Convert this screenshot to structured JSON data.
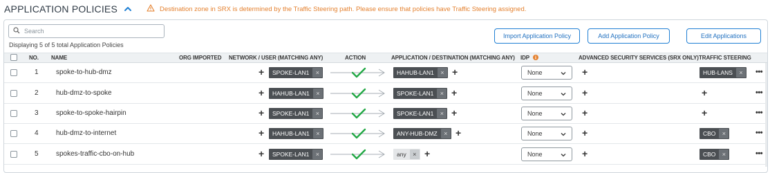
{
  "header": {
    "title": "APPLICATION POLICIES",
    "warning": "Destination zone in SRX is determined by the Traffic Steering path. Please ensure that policies have Traffic Steering assigned."
  },
  "search": {
    "placeholder": "Search",
    "value": ""
  },
  "count_text": "Displaying 5 of 5 total Application Policies",
  "buttons": {
    "import": "Import Application Policy",
    "add": "Add Application Policy",
    "edit": "Edit Applications"
  },
  "columns": {
    "no": "NO.",
    "name": "NAME",
    "org_imported": "ORG IMPORTED",
    "network_user": "NETWORK / USER (MATCHING ANY)",
    "action": "ACTION",
    "app_dest": "APPLICATION / DESTINATION (MATCHING ANY)",
    "idp": "IDP",
    "adv_security": "ADVANCED SECURITY SERVICES (SRX ONLY)",
    "traffic_steering": "TRAFFIC STEERING"
  },
  "rows": [
    {
      "no": "1",
      "name": "spoke-to-hub-dmz",
      "network": "SPOKE-LAN1",
      "destination": "HAHUB-LAN1",
      "idp": "None",
      "steering": "HUB-LANS"
    },
    {
      "no": "2",
      "name": "hub-dmz-to-spoke",
      "network": "HAHUB-LAN1",
      "destination": "SPOKE-LAN1",
      "idp": "None",
      "steering": ""
    },
    {
      "no": "3",
      "name": "spoke-to-spoke-hairpin",
      "network": "SPOKE-LAN1",
      "destination": "SPOKE-LAN1",
      "idp": "None",
      "steering": ""
    },
    {
      "no": "4",
      "name": "hub-dmz-to-internet",
      "network": "HAHUB-LAN1",
      "destination": "ANY-HUB-DMZ",
      "idp": "None",
      "steering": "CBO"
    },
    {
      "no": "5",
      "name": "spokes-traffic-cbo-on-hub",
      "network": "SPOKE-LAN1",
      "destination": "any",
      "idp": "None",
      "steering": "CBO"
    }
  ],
  "symbols": {
    "plus": "+",
    "remove": "×",
    "more": "•••"
  },
  "icons": {
    "collapse": "chevron-up-icon",
    "warning": "warning-triangle-icon",
    "search": "search-icon",
    "idp_info": "info-icon",
    "action": "allow-arrow-check-icon",
    "dropdown": "chevron-down-icon",
    "more": "more-horizontal-icon"
  },
  "colors": {
    "accent": "#1f7fd4",
    "warning": "#e4812f",
    "allow": "#22a845",
    "tag_dark": "#4b4f53",
    "tag_light": "#e4e6e8",
    "header_bg": "#eef1f3"
  }
}
